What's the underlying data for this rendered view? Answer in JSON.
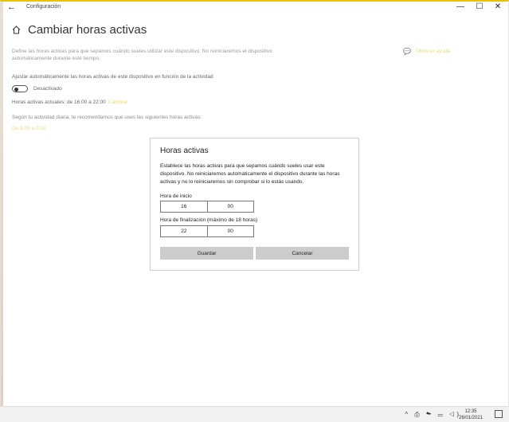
{
  "window": {
    "title": "Configuración",
    "back_icon": "←",
    "minimize_icon": "—",
    "maximize_icon": "☐",
    "close_icon": "✕"
  },
  "page": {
    "title": "Cambiar horas activas",
    "description": "Define las horas activas para que sepamos cuándo sueles utilizar este dispositivo. No reiniciaremos el dispositivo automáticamente durante este tiempo.",
    "help_icon": "💬",
    "help_link": "Obtener ayuda",
    "auto_label": "Ajustar automáticamente las horas activas de este dispositivo en función de la actividad",
    "toggle_label": "Desactivado",
    "current_hours": "Horas activas actuales: de 16:00 a 22:00",
    "change_link": "Cambiar",
    "recommend_text": "Según tu actividad diaria, te recomendamos que uses las siguientes horas activas:",
    "recommend_link": "De 8:00 a 0:00"
  },
  "dialog": {
    "title": "Horas activas",
    "text": "Establece las horas activas para que sepamos cuándo sueles usar este dispositivo. No reiniciaremos automáticamente el dispositivo durante las horas activas y no lo reiniciaremos sin comprobar si lo estás usando.",
    "start_label": "Hora de inicio",
    "start_hour": "16",
    "start_minute": "00",
    "end_label": "Hora de finalización (máximo de 18 horas)",
    "end_hour": "22",
    "end_minute": "00",
    "save_button": "Guardar",
    "cancel_button": "Cancelar"
  },
  "taskbar": {
    "tray_icons": "^ ⎙ ☁ ▭ ◁)",
    "time": "12:35",
    "date": "26/01/2021"
  }
}
